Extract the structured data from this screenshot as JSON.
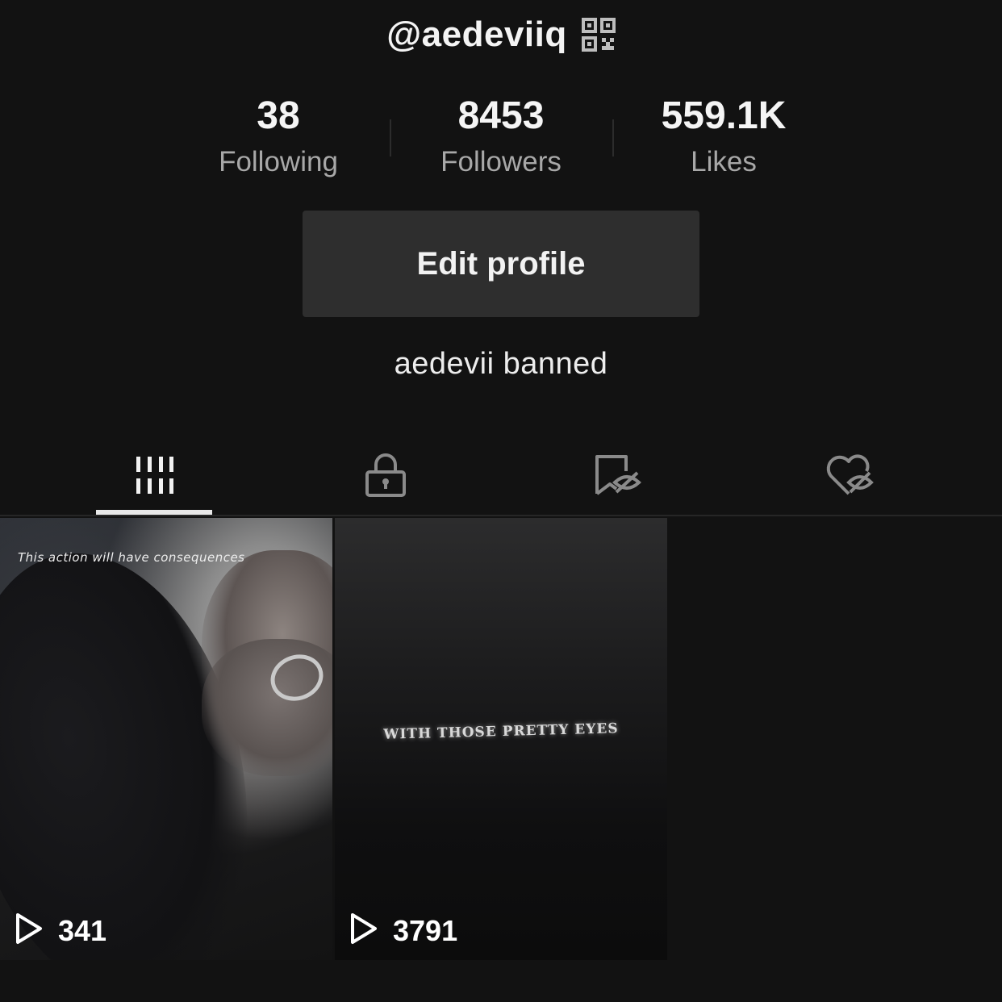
{
  "profile": {
    "username": "@aedeviiq",
    "bio": "aedevii banned",
    "edit_button_label": "Edit profile"
  },
  "stats": [
    {
      "value": "38",
      "label": "Following"
    },
    {
      "value": "8453",
      "label": "Followers"
    },
    {
      "value": "559.1K",
      "label": "Likes"
    }
  ],
  "tabs": [
    {
      "icon": "videos-grid-icon",
      "active": true
    },
    {
      "icon": "private-lock-icon",
      "active": false
    },
    {
      "icon": "hidden-favorites-icon",
      "active": false
    },
    {
      "icon": "hidden-liked-icon",
      "active": false
    }
  ],
  "videos": [
    {
      "overlay_text": "This action will have consequences",
      "views": "341"
    },
    {
      "overlay_text": "WITH THOSE PRETTY EYES",
      "views": "3791"
    }
  ],
  "colors": {
    "background": "#121212",
    "button": "#2e2e2e",
    "muted_text": "#a8a8a8",
    "indicator": "#e8e8e8"
  }
}
